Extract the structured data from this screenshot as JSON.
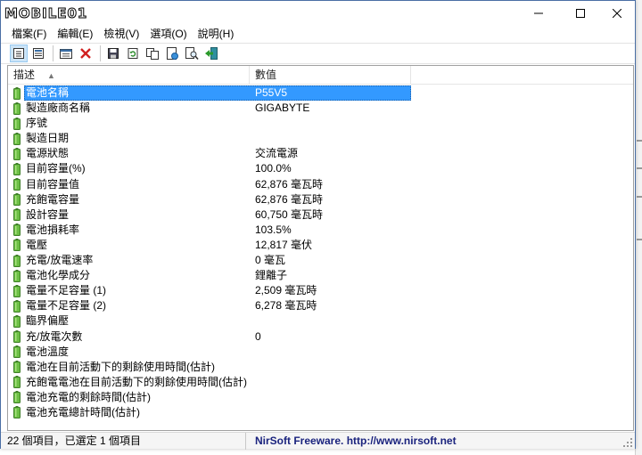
{
  "window": {
    "logo_text": "MOBILE01",
    "controls": {
      "minimize": "minimize",
      "maximize": "maximize",
      "close": "close"
    }
  },
  "menu": [
    "檔案(F)",
    "編輯(E)",
    "檢視(V)",
    "選項(O)",
    "說明(H)"
  ],
  "toolbar": [
    "view-list-icon",
    "view-details-icon",
    "properties-icon",
    "delete-icon",
    "save-icon",
    "refresh-icon",
    "copy-icon",
    "html-report-icon",
    "find-icon",
    "exit-icon"
  ],
  "columns": {
    "description": "描述",
    "value": "數值"
  },
  "rows": [
    {
      "label": "電池名稱",
      "value": "P55V5",
      "selected": true
    },
    {
      "label": "製造廠商名稱",
      "value": "GIGABYTE"
    },
    {
      "label": "序號",
      "value": ""
    },
    {
      "label": "製造日期",
      "value": ""
    },
    {
      "label": "電源狀態",
      "value": "交流電源"
    },
    {
      "label": "目前容量(%)",
      "value": "100.0%"
    },
    {
      "label": "目前容量值",
      "value": "62,876 毫瓦時"
    },
    {
      "label": "充飽電容量",
      "value": "62,876 毫瓦時"
    },
    {
      "label": "設計容量",
      "value": "60,750 毫瓦時"
    },
    {
      "label": "電池損耗率",
      "value": "103.5%"
    },
    {
      "label": "電壓",
      "value": "12,817 毫伏"
    },
    {
      "label": "充電/放電速率",
      "value": "0 毫瓦"
    },
    {
      "label": "電池化學成分",
      "value": "鋰離子"
    },
    {
      "label": "電量不足容量 (1)",
      "value": "2,509 毫瓦時"
    },
    {
      "label": "電量不足容量 (2)",
      "value": "6,278 毫瓦時"
    },
    {
      "label": "臨界偏壓",
      "value": ""
    },
    {
      "label": "充/放電次數",
      "value": "0"
    },
    {
      "label": "電池溫度",
      "value": ""
    },
    {
      "label": "電池在目前活動下的剩餘使用時間(估計)",
      "value": ""
    },
    {
      "label": "充飽電電池在目前活動下的剩餘使用時間(估計)",
      "value": ""
    },
    {
      "label": "電池充電的剩餘時間(估計)",
      "value": ""
    },
    {
      "label": "電池充電總計時間(估計)",
      "value": ""
    }
  ],
  "status": {
    "count": "22 個項目，已選定 1 個項目",
    "credit": "NirSoft Freeware.  http://www.nirsoft.net"
  },
  "background_fragments": [
    "佔",
    "J",
    "J",
    "C",
    "C",
    "C"
  ],
  "colors": {
    "selection": "#3399ff",
    "battery": "#5aa53a",
    "credit": "#1a237e"
  }
}
